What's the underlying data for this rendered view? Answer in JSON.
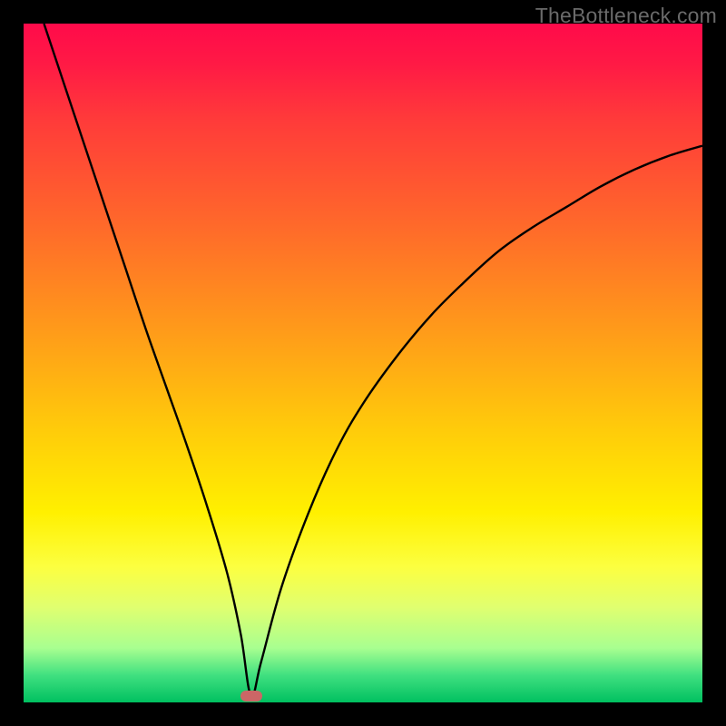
{
  "watermark": "TheBottleneck.com",
  "colors": {
    "curve_stroke": "#000000",
    "marker_fill": "#cc6666",
    "frame_bg": "#000000"
  },
  "chart_data": {
    "type": "line",
    "title": "",
    "xlabel": "",
    "ylabel": "",
    "xlim": [
      0,
      100
    ],
    "ylim": [
      0,
      100
    ],
    "grid": false,
    "legend": false,
    "series": [
      {
        "name": "bottleneck_curve",
        "x": [
          3,
          6,
          9,
          12,
          15,
          18,
          21,
          24,
          27,
          30,
          32,
          33.5,
          35,
          38,
          42,
          46,
          50,
          55,
          60,
          65,
          70,
          75,
          80,
          85,
          90,
          95,
          100
        ],
        "y": [
          100,
          91,
          82,
          73,
          64,
          55,
          46.5,
          38,
          29,
          19,
          10,
          1,
          6,
          17,
          28,
          37,
          44,
          51,
          57,
          62,
          66.5,
          70,
          73,
          76,
          78.5,
          80.5,
          82
        ]
      }
    ],
    "annotations": [
      {
        "name": "min_marker",
        "x": 33.5,
        "y": 1
      }
    ]
  }
}
